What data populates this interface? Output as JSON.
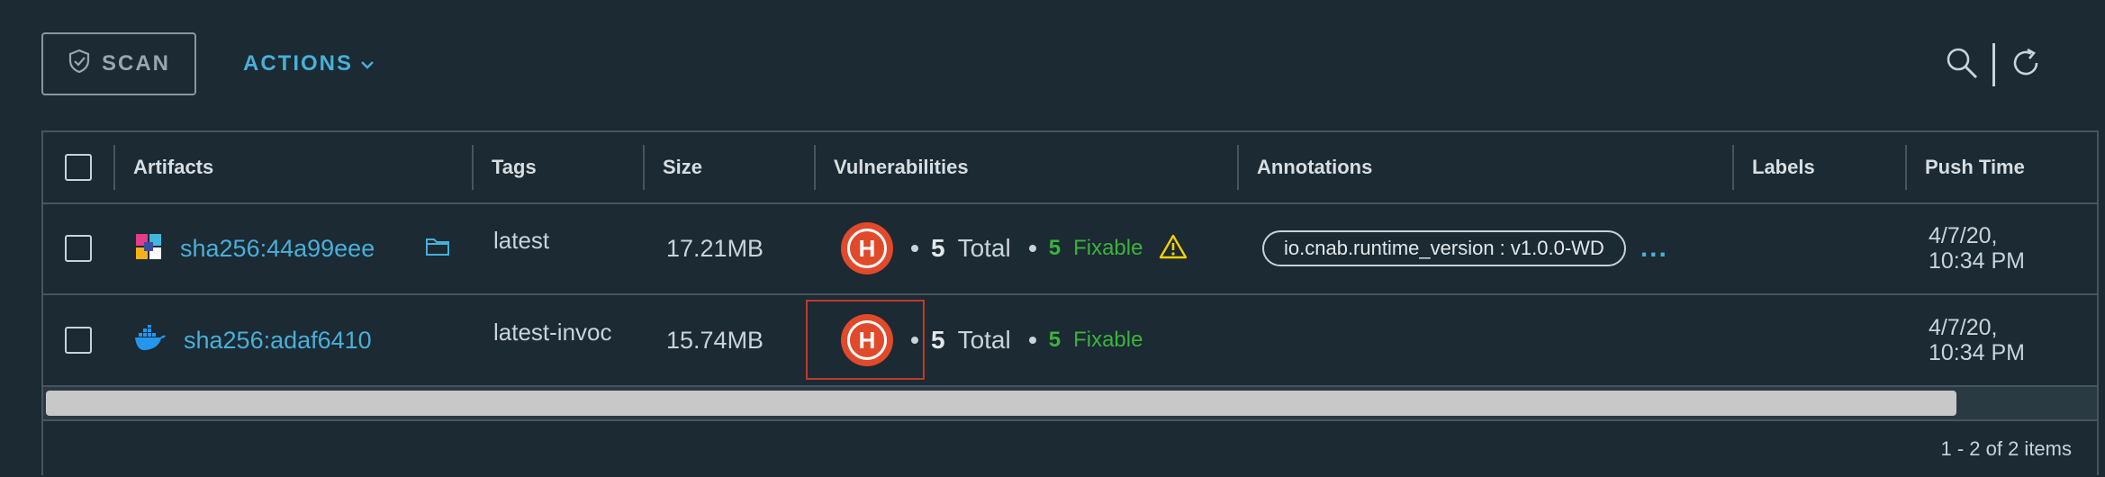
{
  "toolbar": {
    "scan_label": "SCAN",
    "actions_label": "ACTIONS",
    "scan_icon": "shield-check-icon",
    "actions_icon": "chevron-down-icon",
    "search_icon": "search-icon",
    "refresh_icon": "refresh-icon"
  },
  "grid": {
    "columns": [
      "Artifacts",
      "Tags",
      "Size",
      "Vulnerabilities",
      "Annotations",
      "Labels",
      "Push Time"
    ],
    "rows": [
      {
        "artifact_icon": "cnab-bundle-icon",
        "artifact": "sha256:44a99eee",
        "artifact_extra_icon": "folder-icon",
        "tag": "latest",
        "size": "17.21MB",
        "severity": "H",
        "total_count": "5",
        "total_label": "Total",
        "fixable_count": "5",
        "fixable_label": "Fixable",
        "warning_icon": "warning-icon",
        "annotation": "io.cnab.runtime_version : v1.0.0-WD",
        "annotation_more": "...",
        "labels": "",
        "push_time_line1": "4/7/20,",
        "push_time_line2": "10:34 PM"
      },
      {
        "artifact_icon": "docker-icon",
        "artifact": "sha256:adaf6410",
        "tag": "latest-invoc",
        "size": "15.74MB",
        "severity": "H",
        "total_count": "5",
        "total_label": "Total",
        "fixable_count": "5",
        "fixable_label": "Fixable",
        "labels": "",
        "push_time_line1": "4/7/20,",
        "push_time_line2": "10:34 PM"
      }
    ]
  },
  "footer": {
    "pagination": "1 - 2 of 2 items"
  },
  "colors": {
    "background": "#1b2a33",
    "link": "#49afd9",
    "critical": "#e04a2b",
    "fixable": "#3cb33c",
    "warning": "#f5d000"
  }
}
